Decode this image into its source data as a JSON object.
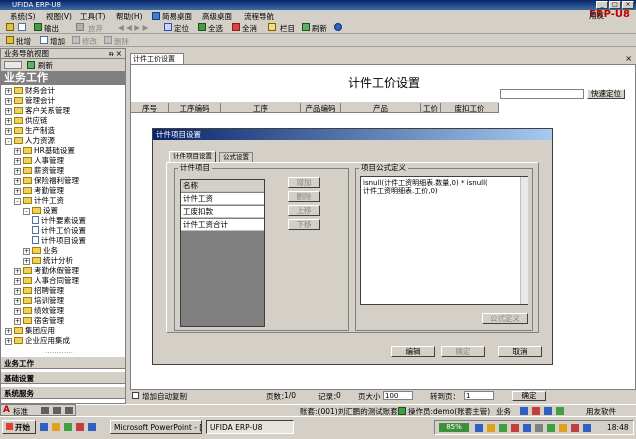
{
  "window": {
    "title": "UFIDA ERP-U8",
    "min": "_",
    "max": "□",
    "close": "×"
  },
  "brand": {
    "text": "用友",
    "suffix": "ERP-U8"
  },
  "menu": [
    "系统(S)",
    "视图(V)",
    "工具(T)",
    "帮助(H)",
    "简易桌面",
    "高级桌面",
    "流程导航"
  ],
  "toolbar1": [
    "输出",
    "放弃",
    "定位",
    "全选",
    "全消",
    "栏目",
    "刷新"
  ],
  "toolbar2": [
    "批增",
    "增加",
    "修改",
    "删除"
  ],
  "nav": {
    "header": "业务导航视图",
    "pin": "ᵰ ×",
    "refresh": "刷新",
    "title": "业务工作",
    "tree": [
      {
        "label": "财务会计",
        "level": 0,
        "pm": "+",
        "kind": "folder"
      },
      {
        "label": "管理会计",
        "level": 0,
        "pm": "+",
        "kind": "folder"
      },
      {
        "label": "客户关系管理",
        "level": 0,
        "pm": "+",
        "kind": "folder"
      },
      {
        "label": "供应链",
        "level": 0,
        "pm": "+",
        "kind": "folder"
      },
      {
        "label": "生产制造",
        "level": 0,
        "pm": "+",
        "kind": "folder"
      },
      {
        "label": "人力资源",
        "level": 0,
        "pm": "-",
        "kind": "folder"
      },
      {
        "label": "HR基础设置",
        "level": 1,
        "pm": "+",
        "kind": "folder"
      },
      {
        "label": "人事管理",
        "level": 1,
        "pm": "+",
        "kind": "folder"
      },
      {
        "label": "薪资管理",
        "level": 1,
        "pm": "+",
        "kind": "folder"
      },
      {
        "label": "保险福利管理",
        "level": 1,
        "pm": "+",
        "kind": "folder"
      },
      {
        "label": "考勤管理",
        "level": 1,
        "pm": "+",
        "kind": "folder"
      },
      {
        "label": "计件工资",
        "level": 1,
        "pm": "-",
        "kind": "folder"
      },
      {
        "label": "设置",
        "level": 2,
        "pm": "-",
        "kind": "folder"
      },
      {
        "label": "计件要素设置",
        "level": 3,
        "pm": "",
        "kind": "doc"
      },
      {
        "label": "计件工价设置",
        "level": 3,
        "pm": "",
        "kind": "doc"
      },
      {
        "label": "计件项目设置",
        "level": 3,
        "pm": "",
        "kind": "doc"
      },
      {
        "label": "业务",
        "level": 2,
        "pm": "+",
        "kind": "folder"
      },
      {
        "label": "统计分析",
        "level": 2,
        "pm": "+",
        "kind": "folder"
      },
      {
        "label": "考勤休假管理",
        "level": 1,
        "pm": "+",
        "kind": "folder"
      },
      {
        "label": "人事合同管理",
        "level": 1,
        "pm": "+",
        "kind": "folder"
      },
      {
        "label": "招聘管理",
        "level": 1,
        "pm": "+",
        "kind": "folder"
      },
      {
        "label": "培训管理",
        "level": 1,
        "pm": "+",
        "kind": "folder"
      },
      {
        "label": "绩效管理",
        "level": 1,
        "pm": "+",
        "kind": "folder"
      },
      {
        "label": "宿舍管理",
        "level": 1,
        "pm": "+",
        "kind": "folder"
      },
      {
        "label": "集团应用",
        "level": 0,
        "pm": "+",
        "kind": "folder"
      },
      {
        "label": "企业应用集成",
        "level": 0,
        "pm": "+",
        "kind": "folder"
      }
    ],
    "dots": "…………",
    "bottom": [
      "业务工作",
      "基础设置",
      "系统服务"
    ]
  },
  "ime": {
    "label": "标准"
  },
  "main": {
    "tab": "计件工价设置",
    "close": "×",
    "title": "计件工价设置",
    "quick_locate": "快速定位",
    "columns": [
      "序号",
      "工序编码",
      "工序",
      "产品编码",
      "产品",
      "工价",
      "废扣工价"
    ]
  },
  "dialog": {
    "title": "计件项目设置",
    "tabs": [
      "计件项目设置",
      "公式设置"
    ],
    "items_group": "计件项目",
    "list_header": "名称",
    "items": [
      "计件工资",
      "工废扣款",
      "计件工资合计"
    ],
    "side_buttons": [
      "增加",
      "删除",
      "上移",
      "下移"
    ],
    "formula_group": "项目公式定义",
    "formula_line1": "isnull(计件工资明细表.数量,0) * isnull(",
    "formula_line2": "计件工资明细表.工价,0)",
    "formula_button": "公式定义",
    "buttons": [
      "编辑",
      "确定",
      "取消"
    ]
  },
  "status": {
    "auto_copy": "增加自动复制",
    "pages_label": "页数：",
    "pages": "1/0",
    "records_label": "记录：",
    "records": "0",
    "page_size_label": "页大小",
    "page_size": "100",
    "goto_label": "转到页：",
    "goto": "1",
    "confirm": "确定"
  },
  "info": {
    "account": "账套:(001)刘汇鹏的测试账套",
    "operator": "操作员:demo(账套主管)",
    "biz": "业务",
    "company": "用友软件"
  },
  "taskbar": {
    "start": "开始",
    "tasks": [
      "Microsoft PowerPoint - [...",
      "UFIDA ERP-U8"
    ],
    "zoom": "85%",
    "time": "18:48"
  }
}
